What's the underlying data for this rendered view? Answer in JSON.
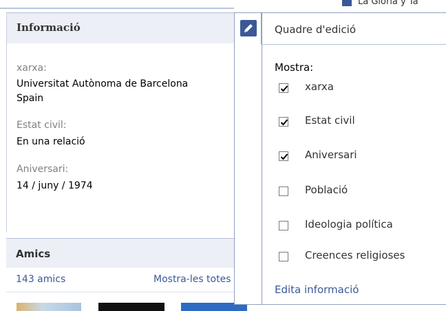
{
  "top_peek": "La Gloria y Ta",
  "info": {
    "title": "Informació",
    "fields": [
      {
        "label": "xarxa:",
        "values": [
          "Universitat Autònoma de Barcelona",
          "Spain"
        ]
      },
      {
        "label": "Estat civil:",
        "values": [
          "En una relació"
        ]
      },
      {
        "label": "Aniversari:",
        "values": [
          "14 / juny / 1974"
        ]
      }
    ]
  },
  "amics": {
    "title": "Amics",
    "count": "143 amics",
    "show_all": "Mostra-les totes"
  },
  "dropdown": {
    "title": "Quadre d'edició",
    "show_label": "Mostra:",
    "options": [
      {
        "label": "xarxa",
        "checked": true
      },
      {
        "label": "Estat civil",
        "checked": true
      },
      {
        "label": "Aniversari",
        "checked": true
      },
      {
        "label": "Població",
        "checked": false
      },
      {
        "label": "Ideologia política",
        "checked": false
      },
      {
        "label": "Creences religioses",
        "checked": false
      }
    ],
    "edit_link": "Edita informació"
  },
  "colors": {
    "accent": "#3b5998",
    "header_bg": "#eceff5"
  }
}
